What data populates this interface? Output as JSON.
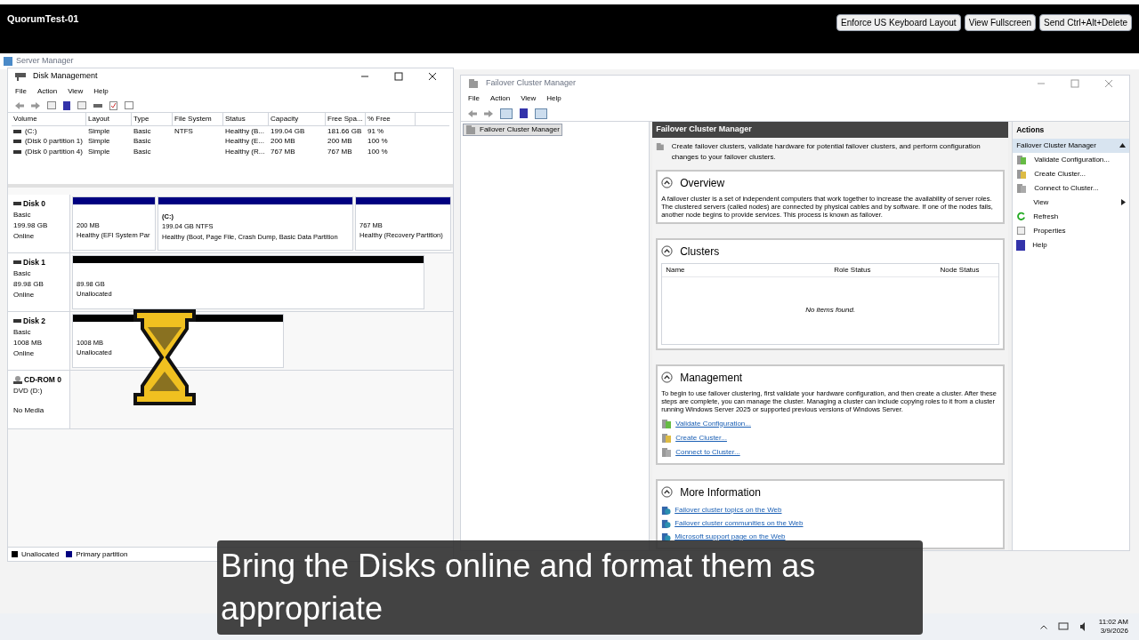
{
  "session": {
    "title": "QuorumTest-01",
    "buttons": [
      "Enforce US Keyboard Layout",
      "View Fullscreen",
      "Send Ctrl+Alt+Delete"
    ]
  },
  "server_manager": {
    "title": "Server Manager"
  },
  "disk_management": {
    "title": "Disk Management",
    "menu": [
      "File",
      "Action",
      "View",
      "Help"
    ],
    "columns": [
      "Volume",
      "Layout",
      "Type",
      "File System",
      "Status",
      "Capacity",
      "Free Spa...",
      "% Free"
    ],
    "rows": [
      [
        "(C:)",
        "Simple",
        "Basic",
        "NTFS",
        "Healthy (B...",
        "199.04 GB",
        "181.66 GB",
        "91 %"
      ],
      [
        "(Disk 0 partition 1)",
        "Simple",
        "Basic",
        "",
        "Healthy (E...",
        "200 MB",
        "200 MB",
        "100 %"
      ],
      [
        "(Disk 0 partition 4)",
        "Simple",
        "Basic",
        "",
        "Healthy (R...",
        "767 MB",
        "767 MB",
        "100 %"
      ]
    ],
    "disks": [
      {
        "name": "Disk 0",
        "kind": "disk",
        "lines": [
          "Basic",
          "199.98 GB",
          "Online"
        ],
        "partitions": [
          {
            "kind": "primary",
            "size": "200 MB",
            "status": "Healthy (EFI System Par"
          },
          {
            "kind": "primary",
            "label": "(C:)",
            "size": "199.04 GB NTFS",
            "status": "Healthy (Boot, Page File, Crash Dump, Basic Data Partition"
          },
          {
            "kind": "primary",
            "size": "767 MB",
            "status": "Healthy (Recovery Partition)"
          }
        ]
      },
      {
        "name": "Disk 1",
        "kind": "disk",
        "lines": [
          "Basic",
          "89.98 GB",
          "Online"
        ],
        "partitions": [
          {
            "kind": "unallocated",
            "size": "89.98 GB",
            "status": "Unallocated"
          }
        ]
      },
      {
        "name": "Disk 2",
        "kind": "disk",
        "lines": [
          "Basic",
          "1008 MB",
          "Online"
        ],
        "partitions": [
          {
            "kind": "unallocated",
            "size": "1008 MB",
            "status": "Unallocated"
          }
        ]
      },
      {
        "name": "CD-ROM 0",
        "kind": "cdrom",
        "lines": [
          "DVD (D:)",
          "No Media"
        ]
      }
    ],
    "legend": [
      {
        "label": "Unallocated",
        "color": "#000000"
      },
      {
        "label": "Primary partition",
        "color": "#000080"
      }
    ]
  },
  "failover": {
    "title": "Failover Cluster Manager",
    "menu": [
      "File",
      "Action",
      "View",
      "Help"
    ],
    "tree": [
      {
        "label": "Failover Cluster Manager",
        "selected": true
      }
    ],
    "header": "Failover Cluster Manager",
    "intro": "Create failover clusters, validate hardware for potential failover clusters, and perform configuration changes to your failover clusters.",
    "overview": {
      "title": "Overview",
      "text": "A failover cluster is a set of independent computers that work together to increase the availability of server roles. The clustered servers (called nodes) are connected by physical cables and by software. If one of the nodes fails, another node begins to provide services. This process is known as failover."
    },
    "clusters": {
      "title": "Clusters",
      "columns": [
        "Name",
        "Role Status",
        "Node Status"
      ],
      "empty": "No items found."
    },
    "management": {
      "title": "Management",
      "text": "To begin to use failover clustering, first validate your hardware configuration, and then create a cluster.  After these steps are complete, you can manage the cluster. Managing a cluster can include copying roles to it from a cluster running Windows Server 2025 or supported previous versions of Windows Server.",
      "links": [
        "Validate Configuration...",
        "Create Cluster...",
        "Connect to Cluster..."
      ]
    },
    "more_info": {
      "title": "More Information",
      "links": [
        "Failover cluster topics on the Web",
        "Failover cluster communities on the Web",
        "Microsoft support page on the Web"
      ]
    },
    "actions": {
      "title": "Actions",
      "items": [
        {
          "label": "Failover Cluster Manager",
          "kind": "header",
          "selected": true
        },
        {
          "label": "Validate Configuration...",
          "kind": "validate",
          "selected": false
        },
        {
          "label": "Create Cluster...",
          "kind": "create",
          "selected": false
        },
        {
          "label": "Connect to Cluster...",
          "kind": "connect",
          "selected": false
        },
        {
          "label": "View",
          "kind": "submenu",
          "selected": false
        },
        {
          "label": "Refresh",
          "kind": "refresh",
          "selected": false
        },
        {
          "label": "Properties",
          "kind": "properties",
          "selected": false
        },
        {
          "label": "Help",
          "kind": "help",
          "selected": false
        }
      ]
    }
  },
  "caption": "Bring the Disks online and format them as appropriate",
  "taskbar": {
    "time": "11:02 AM",
    "date": "3/9/2026"
  }
}
